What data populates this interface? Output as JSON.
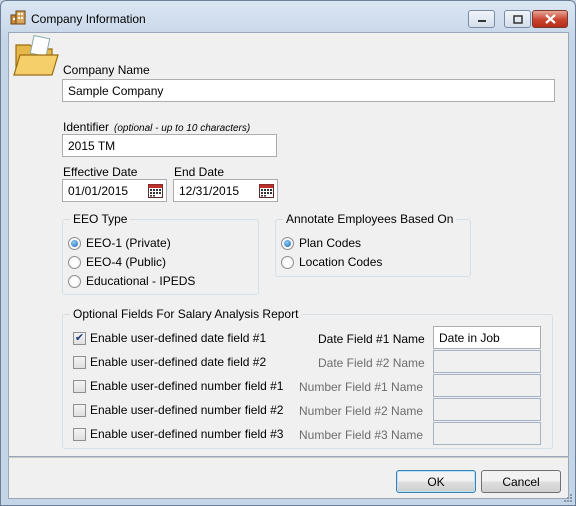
{
  "window": {
    "title": "Company Information",
    "app_icon": "building-icon",
    "controls": [
      "minimize-icon",
      "maximize-icon",
      "close-icon"
    ]
  },
  "header_icon": "open-folder-icon",
  "company_name": {
    "label": "Company Name",
    "value": "Sample Company"
  },
  "identifier": {
    "label": "Identifier",
    "hint": "(optional - up to 10 characters)",
    "value": "2015 TM"
  },
  "effective_date": {
    "label": "Effective Date",
    "value": "01/01/2015",
    "icon": "calendar-icon"
  },
  "end_date": {
    "label": "End Date",
    "value": "12/31/2015",
    "icon": "calendar-icon"
  },
  "eeo_type": {
    "title": "EEO Type",
    "options": [
      {
        "label": "EEO-1 (Private)",
        "selected": true
      },
      {
        "label": "EEO-4 (Public)",
        "selected": false
      },
      {
        "label": "Educational - IPEDS",
        "selected": false
      }
    ]
  },
  "annotate": {
    "title": "Annotate Employees Based On",
    "options": [
      {
        "label": "Plan Codes",
        "selected": true
      },
      {
        "label": "Location Codes",
        "selected": false
      }
    ]
  },
  "salary_fields": {
    "title": "Optional Fields For Salary Analysis Report",
    "rows": [
      {
        "check_label": "Enable user-defined date field #1",
        "checked": true,
        "name_label": "Date Field #1 Name",
        "value": "Date in Job",
        "enabled": true
      },
      {
        "check_label": "Enable user-defined date field #2",
        "checked": false,
        "name_label": "Date Field #2 Name",
        "value": "",
        "enabled": false
      },
      {
        "check_label": "Enable user-defined number field #1",
        "checked": false,
        "name_label": "Number Field #1 Name",
        "value": "",
        "enabled": false
      },
      {
        "check_label": "Enable user-defined number field #2",
        "checked": false,
        "name_label": "Number Field #2 Name",
        "value": "",
        "enabled": false
      },
      {
        "check_label": "Enable user-defined number field #3",
        "checked": false,
        "name_label": "Number Field #3 Name",
        "value": "",
        "enabled": false
      }
    ]
  },
  "buttons": {
    "ok": "OK",
    "cancel": "Cancel"
  },
  "colors": {
    "accent": "#1b5fa8",
    "close": "#c9432f",
    "titlebar": "#c5d5e8"
  }
}
